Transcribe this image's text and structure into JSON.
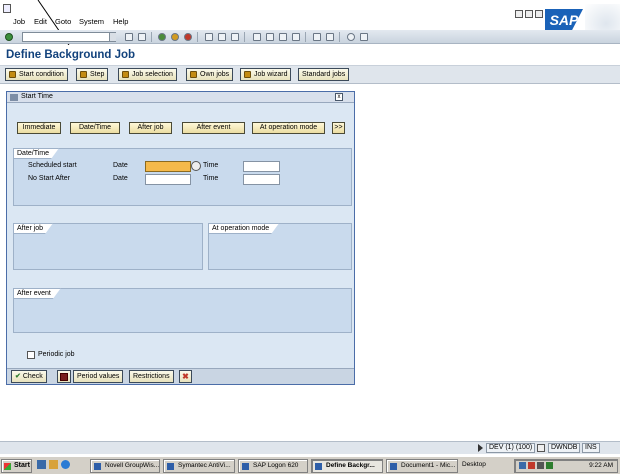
{
  "menu": {
    "items": [
      "Job",
      "Edit",
      "Goto",
      "System",
      "Help"
    ],
    "underline": [
      "J",
      "E",
      "G",
      "S",
      "H"
    ]
  },
  "logo": "SAP",
  "page_title": "Define Background Job",
  "app_toolbar": {
    "buttons": [
      "Start condition",
      "Step",
      "Job selection",
      "Own jobs",
      "Job wizard",
      "Standard jobs"
    ]
  },
  "popup": {
    "title": "Start Time",
    "close": "x",
    "start_buttons": [
      "Immediate",
      "Date/Time",
      "After job",
      "After event",
      "At operation mode",
      ">>"
    ],
    "datetime_group": {
      "title": "Date/Time",
      "scheduled_start": "Scheduled start",
      "no_start_after": "No Start After",
      "date_label": "Date",
      "time_label": "Time",
      "scheduled_date": "",
      "scheduled_time": "",
      "nsa_date": "",
      "nsa_time": ""
    },
    "after_job_group": "After job",
    "op_mode_group": "At operation mode",
    "after_event_group": "After event",
    "periodic_job": "Periodic job",
    "footer": {
      "check": "Check",
      "period_values": "Period values",
      "restrictions": "Restrictions"
    }
  },
  "status_bar": {
    "system": "DEV (1) (100)",
    "server": "DWNDB",
    "mode": "INS"
  },
  "taskbar": {
    "start": "Start",
    "tasks": [
      "Novell GroupWis...",
      "Symantec AntiVi...",
      "SAP Logon 620",
      "Define Backgr...",
      "Document1 - Mic..."
    ],
    "desktop": "Desktop",
    "clock": "9:22 AM"
  },
  "colors": {
    "title_blue": "#12427c",
    "required_field": "#f5b94a",
    "popup_bg": "#dbe7f3"
  }
}
